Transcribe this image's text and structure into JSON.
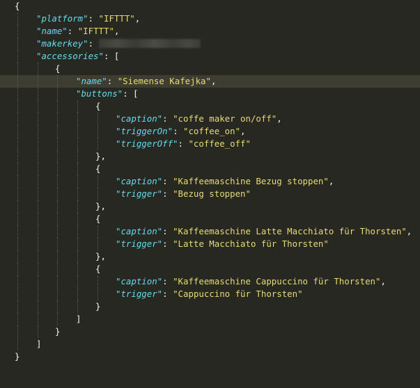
{
  "code": {
    "platform_key": "\"platform\"",
    "platform_value": "\"IFTTT\"",
    "name_key": "\"name\"",
    "name_value": "\"IFTTT\"",
    "makerkey_key": "\"makerkey\"",
    "accessories_key": "\"accessories\"",
    "accessory": {
      "name_key": "\"name\"",
      "name_value": "\"Siemense Kafejka\"",
      "buttons_key": "\"buttons\""
    },
    "buttons": [
      {
        "caption_key": "\"caption\"",
        "caption_value": "\"coffe maker on/off\"",
        "triggerOn_key": "\"triggerOn\"",
        "triggerOn_value": "\"coffee_on\"",
        "triggerOff_key": "\"triggerOff\"",
        "triggerOff_value": "\"coffee_off\""
      },
      {
        "caption_key": "\"caption\"",
        "caption_value": "\"Kaffeemaschine Bezug stoppen\"",
        "trigger_key": "\"trigger\"",
        "trigger_value": "\"Bezug stoppen\""
      },
      {
        "caption_key": "\"caption\"",
        "caption_value": "\"Kaffeemaschine Latte Macchiato für Thorsten\"",
        "trigger_key": "\"trigger\"",
        "trigger_value": "\"Latte Macchiato für Thorsten\""
      },
      {
        "caption_key": "\"caption\"",
        "caption_value": "\"Kaffeemaschine Cappuccino für Thorsten\"",
        "trigger_key": "\"trigger\"",
        "trigger_value": "\"Cappuccino für Thorsten\""
      }
    ]
  },
  "colors": {
    "background": "#272822",
    "active_line": "#3e3d32",
    "key": "#66d9ef",
    "string": "#e6db74",
    "punctuation": "#f8f8f2"
  }
}
